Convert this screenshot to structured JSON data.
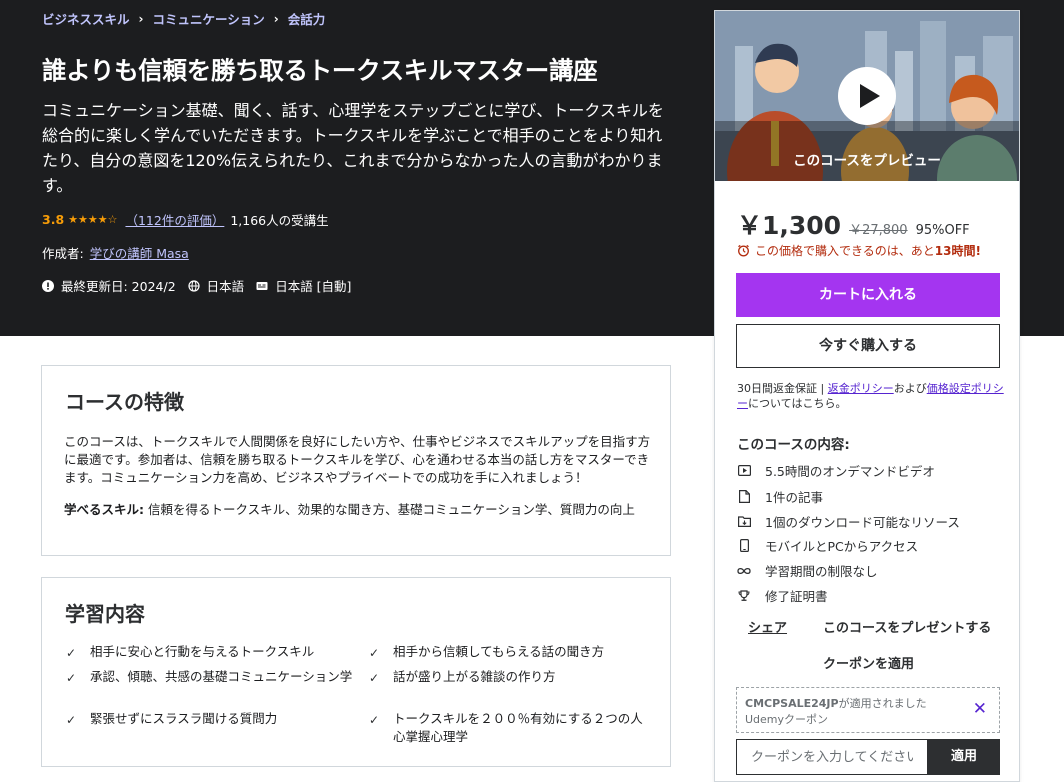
{
  "breadcrumb": [
    "ビジネススキル",
    "コミュニケーション",
    "会話力"
  ],
  "course": {
    "title": "誰よりも信頼を勝ち取るトークスキルマスター講座",
    "subtitle": "コミュニケーション基礎、聞く、話す、心理学をステップごとに学び、トークスキルを総合的に楽しく学んでいただきます。トークスキルを学ぶことで相手のことをより知れたり、自分の意図を120%伝えられたり、これまで分からなかった人の言動がわかります。",
    "rating": "3.8",
    "stars": "★★★★☆",
    "rating_count": "（112件の評価）",
    "students": "1,166人の受講生",
    "author_label": "作成者:",
    "author": "学びの講師 Masa",
    "updated": "最終更新日: 2024/2",
    "language": "日本語",
    "captions": "日本語 [自動]"
  },
  "features": {
    "heading": "コースの特徴",
    "description": "このコースは、トークスキルで人間関係を良好にしたい方や、仕事やビジネスでスキルアップを目指す方に最適です。参加者は、信頼を勝ち取るトークスキルを学び、心を通わせる本当の話し方をマスターできます。コミュニケーション力を高め、ビジネスやプライベートでの成功を手に入れましょう！",
    "skills_label": "学べるスキル:",
    "skills": "信頼を得るトークスキル、効果的な聞き方、基礎コミュニケーション学、質問力の向上"
  },
  "learn": {
    "heading": "学習内容",
    "items": [
      "相手に安心と行動を与えるトークスキル",
      "相手から信頼してもらえる話の聞き方",
      "承認、傾聴、共感の基礎コミュニケーション学",
      "話が盛り上がる雑談の作り方",
      "緊張せずにスラスラ聞ける質問力",
      "トークスキルを２００％有効にする２つの人心掌握心理学"
    ]
  },
  "sidebar": {
    "preview_label": "このコースをプレビュー",
    "price": "￥1,300",
    "original_price": "￥27,800",
    "discount": "95%OFF",
    "timer_prefix": "この価格で購入できるのは、あと",
    "timer_value": "13時間!",
    "cart_button": "カートに入れる",
    "buy_button": "今すぐ購入する",
    "guarantee_1": "30日間返金保証 | ",
    "refund_link": "返金ポリシー",
    "and": "および",
    "pricing_link": "価格設定ポリシー",
    "guarantee_2": "についてはこちら。",
    "includes_title": "このコースの内容:",
    "includes": [
      "5.5時間のオンデマンドビデオ",
      "1件の記事",
      "1個のダウンロード可能なリソース",
      "モバイルとPCからアクセス",
      "学習期間の制限なし",
      "修了証明書"
    ],
    "share": "シェア",
    "gift": "このコースをプレゼントする",
    "apply_coupon": "クーポンを適用",
    "coupon_code": "CMCPSALE24JP",
    "coupon_applied": "が適用されました",
    "coupon_type": "Udemyクーポン",
    "coupon_placeholder": "クーポンを入力してください",
    "coupon_button": "適用"
  }
}
